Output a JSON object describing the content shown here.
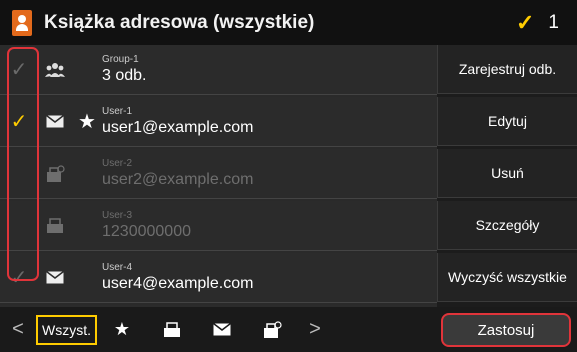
{
  "header": {
    "title": "Książka adresowa (wszystkie)",
    "selected_count": "1",
    "selected_check": "✓"
  },
  "rows": [
    {
      "check": "✓",
      "checked": false,
      "type_icon": "group-icon",
      "favorite": false,
      "name": "Group-1",
      "value": "3 odb.",
      "disabled": false
    },
    {
      "check": "✓",
      "checked": true,
      "type_icon": "email-icon",
      "favorite": true,
      "name": "User-1",
      "value": "user1@example.com",
      "disabled": false
    },
    {
      "check": "",
      "checked": false,
      "type_icon": "ifax-icon",
      "favorite": false,
      "name": "User-2",
      "value": "user2@example.com",
      "disabled": true
    },
    {
      "check": "",
      "checked": false,
      "type_icon": "fax-icon",
      "favorite": false,
      "name": "User-3",
      "value": "1230000000",
      "disabled": true
    },
    {
      "check": "✓",
      "checked": false,
      "type_icon": "email-icon",
      "favorite": false,
      "name": "User-4",
      "value": "user4@example.com",
      "disabled": false
    }
  ],
  "actions": {
    "register": "Zarejestruj odb.",
    "edit": "Edytuj",
    "delete": "Usuń",
    "details": "Szczegóły",
    "clear_all": "Wyczyść wszystkie"
  },
  "bottom": {
    "prev": "<",
    "next": ">",
    "filter_all": "Wszyst.",
    "apply": "Zastosuj"
  },
  "colors": {
    "accent": "#ffcc00",
    "highlight": "#e0343a",
    "brand_icon": "#e36a1c"
  }
}
